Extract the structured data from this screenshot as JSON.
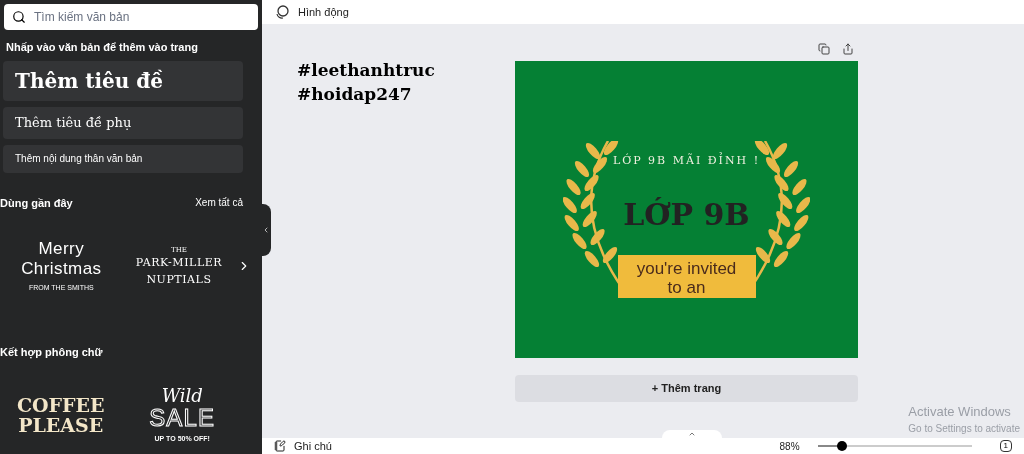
{
  "sidebar": {
    "search": {
      "placeholder": "Tìm kiếm văn bản"
    },
    "hint": "Nhấp vào văn bản để thêm vào trang",
    "text_styles": [
      {
        "kind": "heading",
        "label": "Thêm tiêu đề"
      },
      {
        "kind": "subheading",
        "label": "Thêm tiêu đề phụ"
      },
      {
        "kind": "body",
        "label": "Thêm nội dung thân văn bản"
      }
    ],
    "recent": {
      "title": "Dùng gần đây",
      "see_all": "Xem tất cả",
      "items": [
        {
          "kind": "merry",
          "lines": [
            "Merry",
            "Christmas",
            "FROM THE SMITHS"
          ]
        },
        {
          "kind": "nuptials",
          "lines": [
            "THE",
            "PARK-MILLER",
            "NUPTIALS"
          ]
        }
      ]
    },
    "combos": {
      "title": "Kết hợp phông chữ",
      "items": [
        {
          "kind": "coffee",
          "lines": [
            "COFFEE",
            "PLEASE"
          ]
        },
        {
          "kind": "sale",
          "lines": [
            "Wild",
            "SALE",
            "UP TO 50% OFF!"
          ]
        }
      ]
    }
  },
  "topbar": {
    "label": "Hình động"
  },
  "canvas": {
    "caption": [
      "#leethanhtruc",
      "#hoidap247"
    ],
    "card": {
      "tagline": "LỚP 9B MÃI ĐỈNH !",
      "title": "LỚP 9B",
      "ribbon": "you're invited",
      "ribbon_overflow": "to an"
    },
    "add_page": "+ Thêm trang"
  },
  "bottombar": {
    "notes": "Ghi chú",
    "zoom": "88%",
    "zoom_slider": {
      "level": 0.16
    },
    "page_count": "1"
  },
  "os_watermark": {
    "title": "Activate Windows",
    "subtitle": "Go to Settings to activate"
  }
}
